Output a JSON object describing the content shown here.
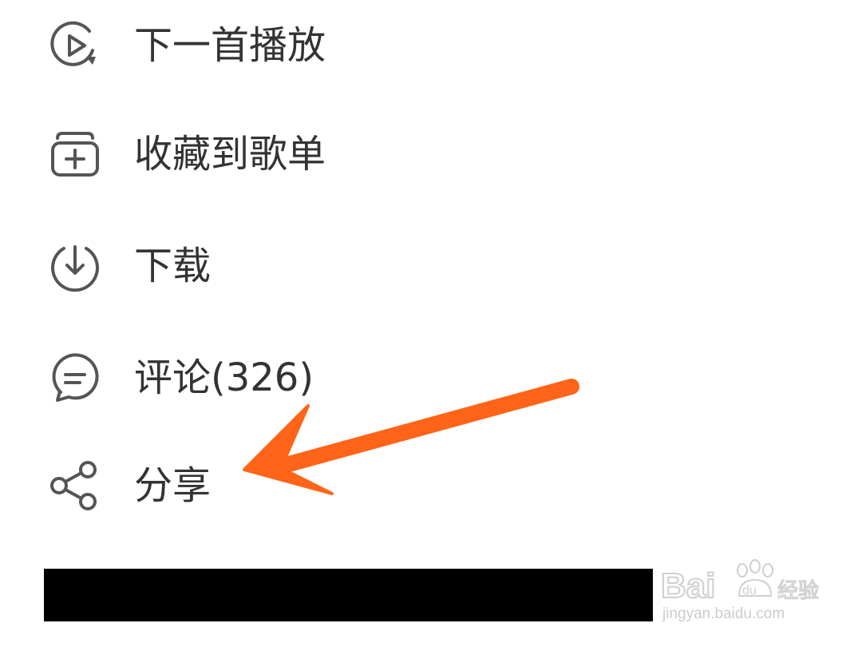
{
  "menu": {
    "items": [
      {
        "label": "下一首播放",
        "icon": "play-next-icon"
      },
      {
        "label": "收藏到歌单",
        "icon": "add-to-playlist-icon"
      },
      {
        "label": "下载",
        "icon": "download-icon"
      },
      {
        "label": "评论(326)",
        "icon": "comment-icon"
      },
      {
        "label": "分享",
        "icon": "share-icon"
      }
    ]
  },
  "annotation": {
    "arrow_color": "#ff6418"
  },
  "watermark": {
    "brand": "Bai du 经验",
    "url": "jingyan.baidu.com"
  },
  "colors": {
    "icon_stroke": "#555555",
    "label_text": "#333333",
    "redaction": "#000000"
  }
}
